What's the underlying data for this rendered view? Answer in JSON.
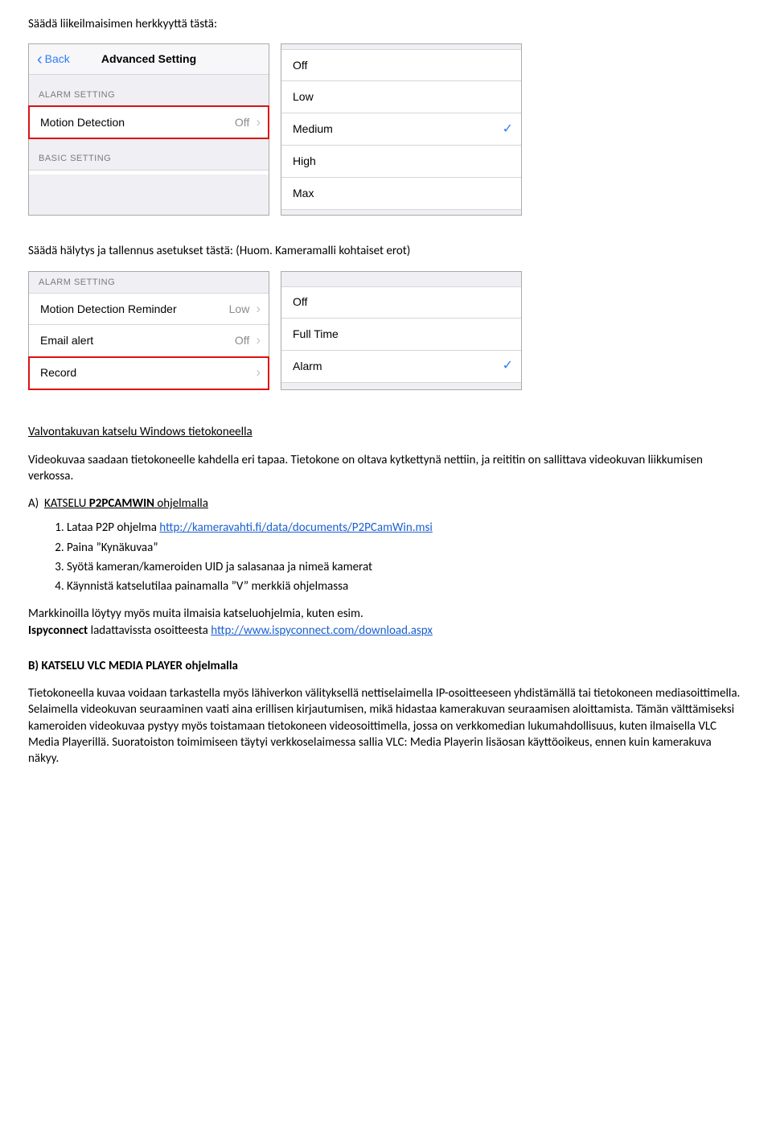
{
  "headings": {
    "h1": "Säädä liikeilmaisimen herkkyyttä tästä:",
    "h2": "Säädä hälytys ja tallennus asetukset tästä: (Huom. Kameramalli kohtaiset erot)",
    "h3": "Valvontakuvan katselu Windows tietokoneella",
    "subA": "A)  KATSELU P2PCAMWIN ohjelmalla",
    "subB": "B)  KATSELU VLC MEDIA PLAYER ohjelmalla"
  },
  "panel1": {
    "back": "Back",
    "title": "Advanced Setting",
    "group1": "ALARM SETTING",
    "item1_label": "Motion Detection",
    "item1_value": "Off",
    "group2": "BASIC SETTING"
  },
  "panel2": {
    "options": [
      "Off",
      "Low",
      "Medium",
      "High",
      "Max"
    ],
    "selected": "Medium"
  },
  "panel3": {
    "group": "ALARM SETTING",
    "item1_label": "Motion Detection Reminder",
    "item1_value": "Low",
    "item2_label": "Email alert",
    "item2_value": "Off",
    "item3_label": "Record"
  },
  "panel4": {
    "options": [
      "Off",
      "Full Time",
      "Alarm"
    ],
    "selected": "Alarm"
  },
  "paragraphs": {
    "p1": "Videokuvaa saadaan tietokoneelle kahdella eri tapaa. Tietokone on oltava kytkettynä nettiin, ja reititin on sallittava videokuvan liikkumisen verkossa.",
    "p2a": "Markkinoilla löytyy myös muita ilmaisia katseluohjelmia, kuten esim.",
    "p2b_prefix": "Ispyconnect",
    "p2b_mid": " ladattavissta osoitteesta ",
    "p3": "Tietokoneella kuvaa voidaan tarkastella myös lähiverkon välityksellä nettiselaimella IP-osoitteeseen yhdistämällä tai tietokoneen mediasoittimella. Selaimella videokuvan seuraaminen vaati aina erillisen kirjautumisen, mikä hidastaa kamerakuvan seuraamisen aloittamista. Tämän välttämiseksi kameroiden videokuvaa pystyy myös toistamaan tietokoneen videosoittimella, jossa on verkkomedian lukumahdollisuus, kuten ilmaisella VLC Media Playerillä. Suoratoiston toimimiseen täytyi verkkoselaimessa sallia VLC: Media Playerin lisäosan käyttöoikeus, ennen kuin kamerakuva näkyy."
  },
  "listA": {
    "i1_pre": "Lataa P2P ohjelma  ",
    "i1_link": "http://kameravahti.fi/data/documents/P2PCamWin.msi",
    "i2": "Paina ”Kynäkuvaa”",
    "i3": "Syötä kameran/kameroiden UID ja salasanaa ja nimeä kamerat",
    "i4": "Käynnistä katselutilaa painamalla ”V” merkkiä ohjelmassa"
  },
  "links": {
    "ispy": "http://www.ispyconnect.com/download.aspx"
  }
}
